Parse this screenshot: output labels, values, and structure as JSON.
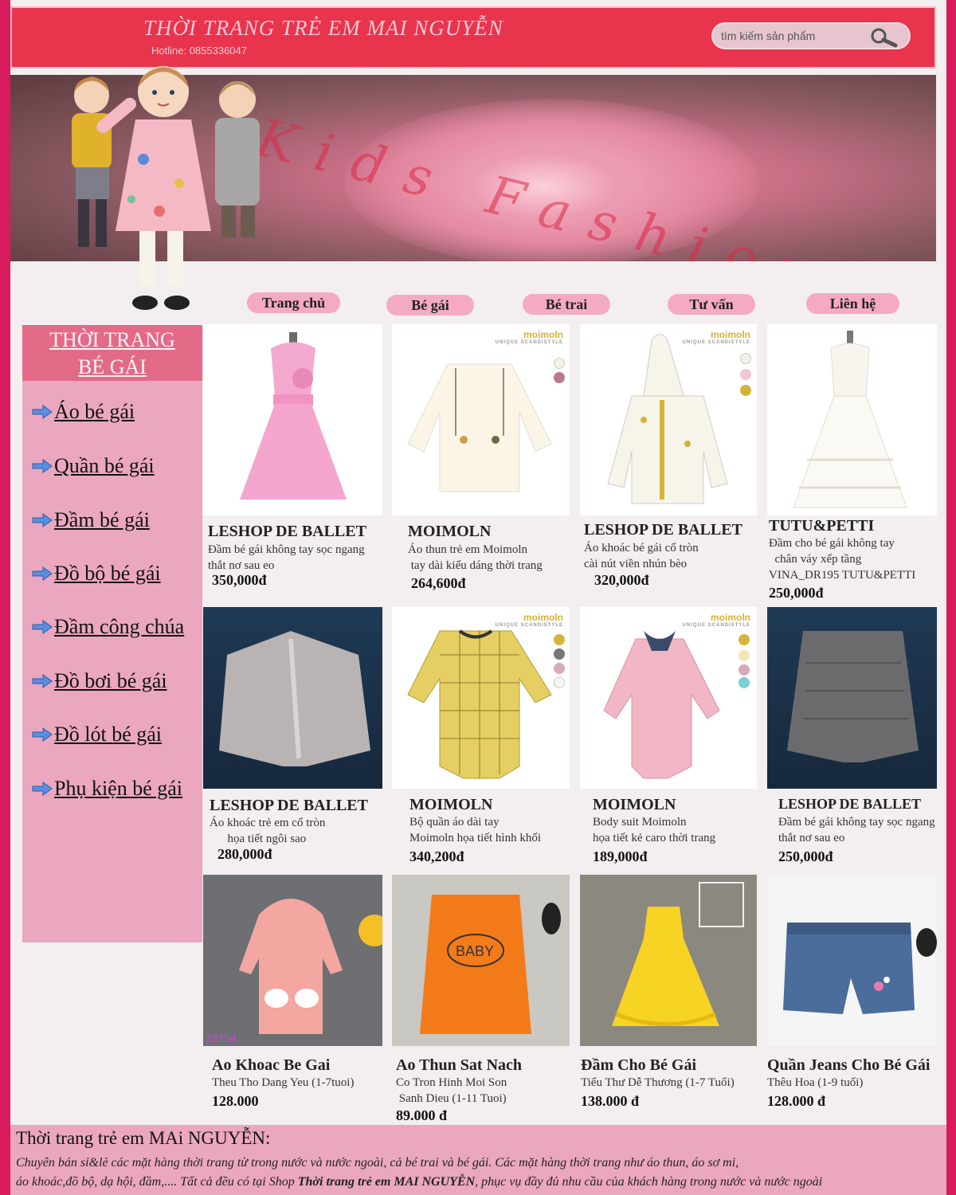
{
  "header": {
    "title": "THỜI TRANG TRẺ EM MAI NGUYỄN",
    "hotline": "Hotline: 0855336047",
    "search_placeholder": "tìm kiếm sản phẩm"
  },
  "banner": {
    "text": "Kids Fashions"
  },
  "nav": {
    "items": [
      "Trang chủ",
      "Bé gái",
      "Bé trai",
      "Tư vấn",
      "Liên hệ"
    ]
  },
  "sidebar": {
    "heading_line1": "THỜI TRANG",
    "heading_line2": "BÉ GÁI",
    "items": [
      "Áo bé gái",
      "Quần bé gái",
      "Đầm bé gái",
      "Đồ bộ bé gái",
      "Đầm công chúa",
      "Đồ bơi bé gái",
      "Đồ lót bé gái",
      "Phụ kiện bé gái"
    ]
  },
  "products": [
    {
      "name": "LESHOP DE BALLET",
      "desc": "Đầm bé gái không tay sọc ngang\nthắt nơ sau eo",
      "price": "350,000đ"
    },
    {
      "name": "MOIMOLN",
      "desc": "Áo thun trẻ em Moimoln\n tay dài kiểu dáng thời trang",
      "price": "264,600đ",
      "brand": "moimoln",
      "brand_sub": "UNIQUE SCANDISTYLE"
    },
    {
      "name": "LESHOP DE BALLET",
      "desc": "Áo khoác bé gái cổ tròn\ncài nút viền nhún bèo",
      "price": "320,000đ",
      "brand": "moimoln",
      "brand_sub": "UNIQUE SCANDISTYLE"
    },
    {
      "name": "TUTU&PETTI",
      "desc": "Đầm cho bé gái không tay\n  chân váy xếp tầng\nVINA_DR195 TUTU&PETTI",
      "price": "250,000đ"
    },
    {
      "name": "LESHOP DE BALLET",
      "desc": "Áo khoác trẻ em cổ tròn\n      họa tiết ngôi sao",
      "price": "280,000đ"
    },
    {
      "name": "MOIMOLN",
      "desc": "Bộ quần áo dài tay\nMoimoln họa tiết hình khối",
      "price": "340,200đ",
      "brand": "moimoln",
      "brand_sub": "UNIQUE SCANDISTYLE"
    },
    {
      "name": "MOIMOLN",
      "desc": "Body suit Moimoln\nhọa tiết kẻ caro thời trang",
      "price": "189,000đ",
      "brand": "moimoln",
      "brand_sub": "UNIQUE SCANDISTYLE"
    },
    {
      "name": "LESHOP DE BALLET",
      "desc": "Đầm bé gái không tay sọc ngang\nthắt nơ sau eo",
      "price": "250,000đ"
    },
    {
      "name": "Ao Khoac Be Gai",
      "desc": "Theu Tho Dang Yeu (1-7tuoi)",
      "price": "128.000",
      "img_label": "33254"
    },
    {
      "name": "Ao Thun Sat Nach",
      "desc": "Co Tron Hinh Moi Son\n Sanh Dieu (1-11 Tuoi)",
      "price": "89.000 đ",
      "img_label": "BABY"
    },
    {
      "name": "Đầm Cho Bé Gái",
      "desc": "Tiểu Thư Dễ Thương (1-7 Tuổi)",
      "price": "138.000 đ"
    },
    {
      "name": "Quần Jeans Cho Bé Gái",
      "desc": "Thêu Hoa (1-9 tuổi)",
      "price": "128.000 đ"
    }
  ],
  "footer": {
    "title": "Thời trang trẻ em MAi NGUYỄN:",
    "line1": "Chuyên bán sỉ&lẻ các mặt hàng thời trang từ trong nước và nước ngoài, cả bé trai và bé gái. Các mặt hàng thời trang như áo thun, áo sơ mi,",
    "line2_a": "áo khoác,đồ bộ, dạ hội, đầm,.... Tất cả đều có tại Shop ",
    "line2_bold": "Thời trang trẻ em MAI NGUYỄN",
    "line2_b": ", phục vụ đầy đủ nhu cầu của khách hàng trong nước và nước ngoài"
  },
  "colors": {
    "outer": "#d81b5c",
    "header": "#e8344d",
    "sidebar": "#eba7bf",
    "nav_pill": "#f4aac3"
  }
}
